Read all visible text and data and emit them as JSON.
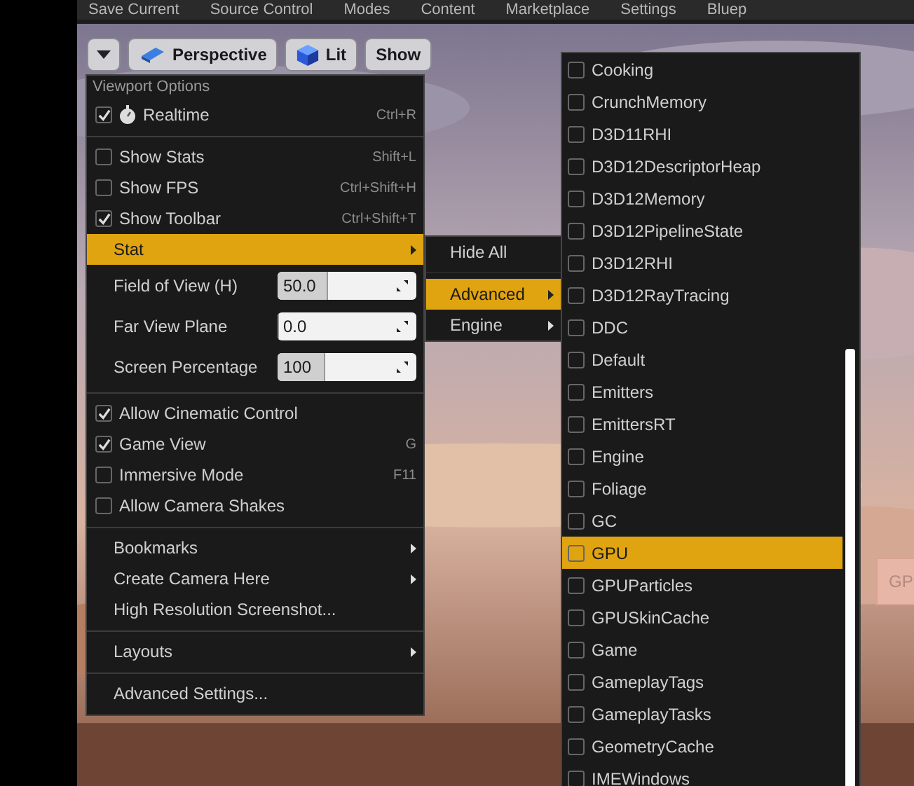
{
  "top_menu": [
    "Save Current",
    "Source Control",
    "Modes",
    "Content",
    "Marketplace",
    "Settings",
    "Bluep"
  ],
  "toolbar": [
    {
      "kind": "caret"
    },
    {
      "kind": "perspective",
      "label": "Perspective"
    },
    {
      "kind": "lit",
      "label": "Lit"
    },
    {
      "kind": "text",
      "label": "Show"
    }
  ],
  "viewport_menu": {
    "header": "Viewport Options",
    "items": [
      {
        "kind": "check_icon",
        "label": "Realtime",
        "checked": true,
        "shortcut": "Ctrl+R"
      },
      {
        "kind": "separator"
      },
      {
        "kind": "check",
        "label": "Show Stats",
        "checked": false,
        "shortcut": "Shift+L"
      },
      {
        "kind": "check",
        "label": "Show FPS",
        "checked": false,
        "shortcut": "Ctrl+Shift+H"
      },
      {
        "kind": "check",
        "label": "Show Toolbar",
        "checked": true,
        "shortcut": "Ctrl+Shift+T"
      },
      {
        "kind": "submenu",
        "label": "Stat",
        "selected": true
      },
      {
        "kind": "field",
        "label": "Field of View (H)",
        "value": "50.0",
        "level": 0.35
      },
      {
        "kind": "field",
        "label": "Far View Plane",
        "value": "0.0",
        "level": 0
      },
      {
        "kind": "field",
        "label": "Screen Percentage",
        "value": "100",
        "level": 0.33
      },
      {
        "kind": "separator"
      },
      {
        "kind": "check",
        "label": "Allow Cinematic Control",
        "checked": true
      },
      {
        "kind": "check",
        "label": "Game View",
        "checked": true,
        "shortcut": "G"
      },
      {
        "kind": "check",
        "label": "Immersive Mode",
        "checked": false,
        "shortcut": "F11"
      },
      {
        "kind": "check",
        "label": "Allow Camera Shakes",
        "checked": false
      },
      {
        "kind": "separator"
      },
      {
        "kind": "submenu",
        "label": "Bookmarks",
        "selected": false
      },
      {
        "kind": "submenu",
        "label": "Create Camera Here",
        "selected": false
      },
      {
        "kind": "action",
        "label": "High Resolution Screenshot..."
      },
      {
        "kind": "separator"
      },
      {
        "kind": "submenu",
        "label": "Layouts",
        "selected": false
      },
      {
        "kind": "separator"
      },
      {
        "kind": "action",
        "label": "Advanced Settings..."
      }
    ]
  },
  "stat_menu": [
    {
      "kind": "action",
      "label": "Hide All"
    },
    {
      "kind": "separator"
    },
    {
      "kind": "submenu",
      "label": "Advanced",
      "selected": true
    },
    {
      "kind": "submenu",
      "label": "Engine",
      "selected": false
    }
  ],
  "advanced_stats": [
    {
      "label": "Cooking",
      "checked": false,
      "selected": false
    },
    {
      "label": "CrunchMemory",
      "checked": false,
      "selected": false
    },
    {
      "label": "D3D11RHI",
      "checked": false,
      "selected": false
    },
    {
      "label": "D3D12DescriptorHeap",
      "checked": false,
      "selected": false
    },
    {
      "label": "D3D12Memory",
      "checked": false,
      "selected": false
    },
    {
      "label": "D3D12PipelineState",
      "checked": false,
      "selected": false
    },
    {
      "label": "D3D12RHI",
      "checked": false,
      "selected": false
    },
    {
      "label": "D3D12RayTracing",
      "checked": false,
      "selected": false
    },
    {
      "label": "DDC",
      "checked": false,
      "selected": false
    },
    {
      "label": "Default",
      "checked": false,
      "selected": false
    },
    {
      "label": "Emitters",
      "checked": false,
      "selected": false
    },
    {
      "label": "EmittersRT",
      "checked": false,
      "selected": false
    },
    {
      "label": "Engine",
      "checked": false,
      "selected": false
    },
    {
      "label": "Foliage",
      "checked": false,
      "selected": false
    },
    {
      "label": "GC",
      "checked": false,
      "selected": false
    },
    {
      "label": "GPU",
      "checked": false,
      "selected": true
    },
    {
      "label": "GPUParticles",
      "checked": false,
      "selected": false
    },
    {
      "label": "GPUSkinCache",
      "checked": false,
      "selected": false
    },
    {
      "label": "Game",
      "checked": false,
      "selected": false
    },
    {
      "label": "GameplayTags",
      "checked": false,
      "selected": false
    },
    {
      "label": "GameplayTasks",
      "checked": false,
      "selected": false
    },
    {
      "label": "GeometryCache",
      "checked": false,
      "selected": false
    },
    {
      "label": "IMEWindows",
      "checked": false,
      "selected": false
    }
  ],
  "tooltip": "GP"
}
